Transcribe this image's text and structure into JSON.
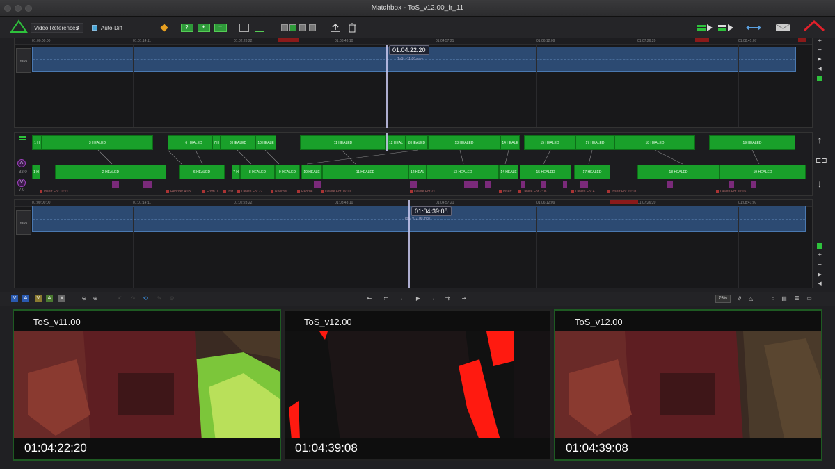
{
  "window": {
    "title": "Matchbox - ToS_v12.00_fr_11"
  },
  "toolbar": {
    "reference_select": "Video References",
    "auto_diff_label": "Auto-Diff",
    "auto_diff_checked": true
  },
  "top_panel": {
    "track_label": "REV1",
    "playhead_tc": "01:04:22:20",
    "clip_name": "ToS_v11.00.mov",
    "ruler": [
      "01:00:00:00",
      "01:01:14:11",
      "01:02:28:22",
      "01:03:43:10",
      "01:04:57:21",
      "01:06:12:09",
      "01:07:26:20",
      "01:08:41:07"
    ]
  },
  "bottom_panel": {
    "track_label": "REV1",
    "playhead_tc": "01:04:39:08",
    "clip_name": "ToS_v12.00.mov",
    "ruler": [
      "01:00:00:00",
      "01:01:14:11",
      "01:02:28:22",
      "01:03:43:10",
      "01:04:57:21",
      "01:06:12:09",
      "01:07:26:20",
      "01:08:41:07"
    ]
  },
  "diff": {
    "upper_values": [
      "32.0"
    ],
    "lower_values": [
      "7.0"
    ],
    "top_row": [
      "1 H",
      "3 HEALED",
      "6 HEALED",
      "7 H",
      "8 HEALED",
      "10 HEALE",
      "11 HEALED",
      "12 HEAL",
      "8 HEALED",
      "13 HEALED",
      "14 HEALE",
      "15 HEALED",
      "17 HEALED",
      "18 HEALED",
      "19 HEALED"
    ],
    "bottom_row": [
      "1 H",
      "2 HEALED",
      "6 HEALED",
      "7 H",
      "8 HEALED",
      "9 HEALED",
      "10 HEALE",
      "11 HEALED",
      "12 HEAL",
      "13 HEALED",
      "14 HEALE",
      "15 HEALED",
      "17 HEALED",
      "18 HEALED",
      "19 HEALED"
    ],
    "changes": [
      "Insert For 10:21",
      "Reorder 4:05",
      "From 0",
      "Inst",
      "Delete For 22",
      "Reorder",
      "Reorde",
      "Delete For 16:10",
      "Delete For 21",
      "Insert",
      "Delete For 2:06",
      "Delete For 4",
      "Insert For 20:03",
      "Delete For 10:05"
    ]
  },
  "transport": {
    "track_toggles": [
      "V",
      "A",
      "V",
      "A",
      "X"
    ],
    "zoom": "75%"
  },
  "viewers": [
    {
      "name": "ToS_v11.00",
      "timecode": "01:04:22:20"
    },
    {
      "name": "ToS_v12.00",
      "timecode": "01:04:39:08"
    },
    {
      "name": "ToS_v12.00",
      "timecode": "01:04:39:08"
    }
  ],
  "colors": {
    "accent_green": "#19a02a",
    "clip_blue": "#2c4a72",
    "diff_red": "#ff1a10"
  }
}
